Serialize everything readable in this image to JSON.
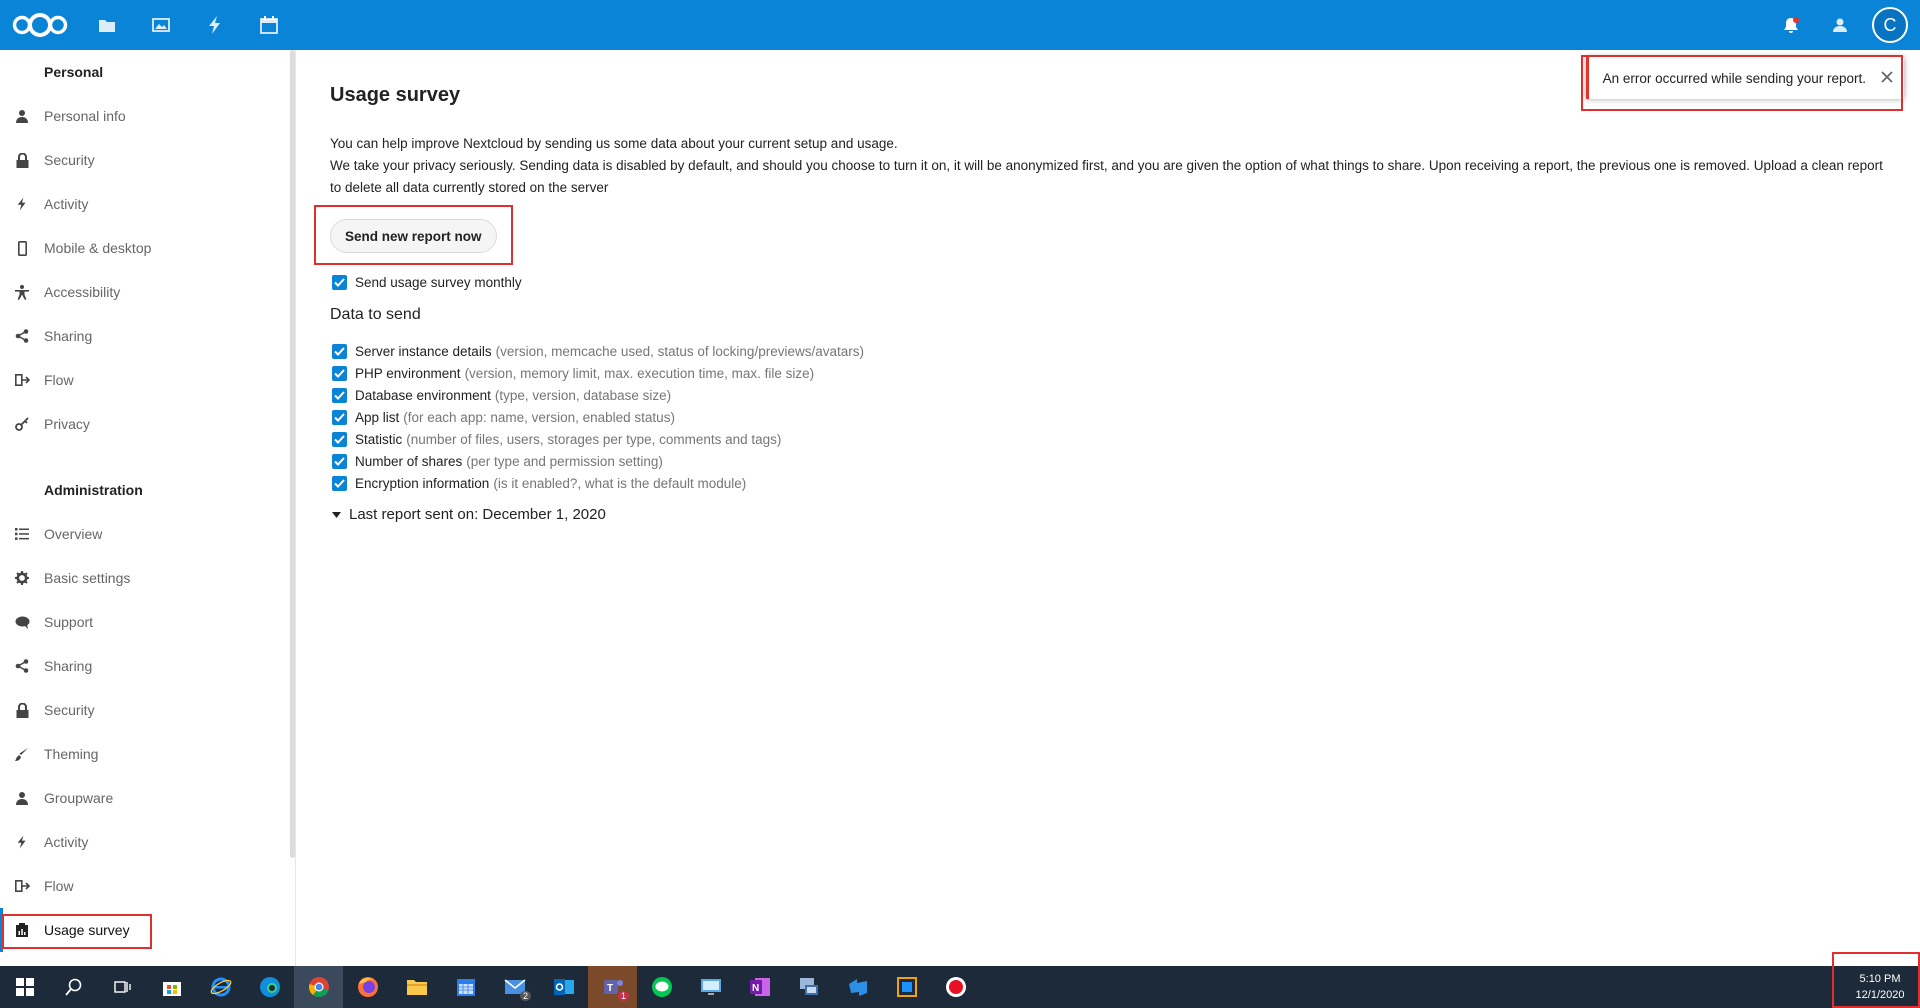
{
  "header": {
    "logo": "nextcloud-logo",
    "apps": [
      {
        "icon": "folder-icon",
        "name": "files-app"
      },
      {
        "icon": "image-icon",
        "name": "photos-app"
      },
      {
        "icon": "lightning-icon",
        "name": "activity-app"
      },
      {
        "icon": "calendar-icon",
        "name": "calendar-app"
      }
    ],
    "avatar_letter": "C",
    "accent_color": "#0a84d6"
  },
  "sidebar": {
    "personal_title": "Personal",
    "personal_items": [
      {
        "label": "Personal info",
        "icon": "user-icon"
      },
      {
        "label": "Security",
        "icon": "lock-icon"
      },
      {
        "label": "Activity",
        "icon": "lightning-icon"
      },
      {
        "label": "Mobile & desktop",
        "icon": "phone-icon"
      },
      {
        "label": "Accessibility",
        "icon": "accessibility-icon"
      },
      {
        "label": "Sharing",
        "icon": "share-icon"
      },
      {
        "label": "Flow",
        "icon": "flow-icon"
      },
      {
        "label": "Privacy",
        "icon": "key-icon"
      }
    ],
    "admin_title": "Administration",
    "admin_items": [
      {
        "label": "Overview",
        "icon": "list-icon"
      },
      {
        "label": "Basic settings",
        "icon": "gear-icon"
      },
      {
        "label": "Support",
        "icon": "speech-bubble-icon"
      },
      {
        "label": "Sharing",
        "icon": "share-icon"
      },
      {
        "label": "Security",
        "icon": "lock-icon"
      },
      {
        "label": "Theming",
        "icon": "brush-icon"
      },
      {
        "label": "Groupware",
        "icon": "group-icon"
      },
      {
        "label": "Activity",
        "icon": "lightning-icon"
      },
      {
        "label": "Flow",
        "icon": "flow-icon"
      },
      {
        "label": "Usage survey",
        "icon": "clipboard-icon",
        "active": true
      }
    ]
  },
  "content": {
    "title": "Usage survey",
    "description_1": "You can help improve Nextcloud by sending us some data about your current setup and usage.",
    "description_2": "We take your privacy seriously. Sending data is disabled by default, and should you choose to turn it on, it will be anonymized first, and you are given the option of what things to share. Upon receiving a report, the previous one is removed. Upload a clean report to delete all data currently stored on the server",
    "send_button": "Send new report now",
    "monthly_label": "Send usage survey monthly",
    "monthly_checked": true,
    "data_heading": "Data to send",
    "data_items": [
      {
        "label": "Server instance details",
        "hint": "(version, memcache used, status of locking/previews/avatars)",
        "checked": true
      },
      {
        "label": "PHP environment",
        "hint": "(version, memory limit, max. execution time, max. file size)",
        "checked": true
      },
      {
        "label": "Database environment",
        "hint": "(type, version, database size)",
        "checked": true
      },
      {
        "label": "App list",
        "hint": "(for each app: name, version, enabled status)",
        "checked": true
      },
      {
        "label": "Statistic",
        "hint": "(number of files, users, storages per type, comments and tags)",
        "checked": true
      },
      {
        "label": "Number of shares",
        "hint": "(per type and permission setting)",
        "checked": true
      },
      {
        "label": "Encryption information",
        "hint": "(is it enabled?, what is the default module)",
        "checked": true
      }
    ],
    "last_report": "Last report sent on: December 1, 2020"
  },
  "toast": {
    "message": "An error occurred while sending your report."
  },
  "taskbar": {
    "apps": [
      {
        "name": "search",
        "icon": "search-icon"
      },
      {
        "name": "task-view",
        "icon": "task-view-icon"
      },
      {
        "name": "store",
        "icon": "store-icon"
      },
      {
        "name": "internet-explorer",
        "icon": "ie-icon"
      },
      {
        "name": "edge",
        "icon": "edge-icon"
      },
      {
        "name": "chrome",
        "icon": "chrome-icon",
        "active": true
      },
      {
        "name": "firefox",
        "icon": "firefox-icon"
      },
      {
        "name": "file-explorer",
        "icon": "folder-icon"
      },
      {
        "name": "calendar",
        "icon": "calendar-icon"
      },
      {
        "name": "mail",
        "icon": "mail-icon",
        "badge": "2"
      },
      {
        "name": "outlook",
        "icon": "outlook-icon"
      },
      {
        "name": "teams",
        "icon": "teams-icon",
        "badge": "1"
      },
      {
        "name": "line",
        "icon": "line-icon"
      },
      {
        "name": "remote-desktop",
        "icon": "monitor-icon"
      },
      {
        "name": "onenote",
        "icon": "onenote-icon"
      },
      {
        "name": "network",
        "icon": "network-icon"
      },
      {
        "name": "azure-devops",
        "icon": "devops-icon"
      },
      {
        "name": "virtualbox",
        "icon": "virtualbox-icon"
      },
      {
        "name": "recorder",
        "icon": "record-icon"
      }
    ],
    "time": "5:10 PM",
    "date": "12/1/2020"
  }
}
